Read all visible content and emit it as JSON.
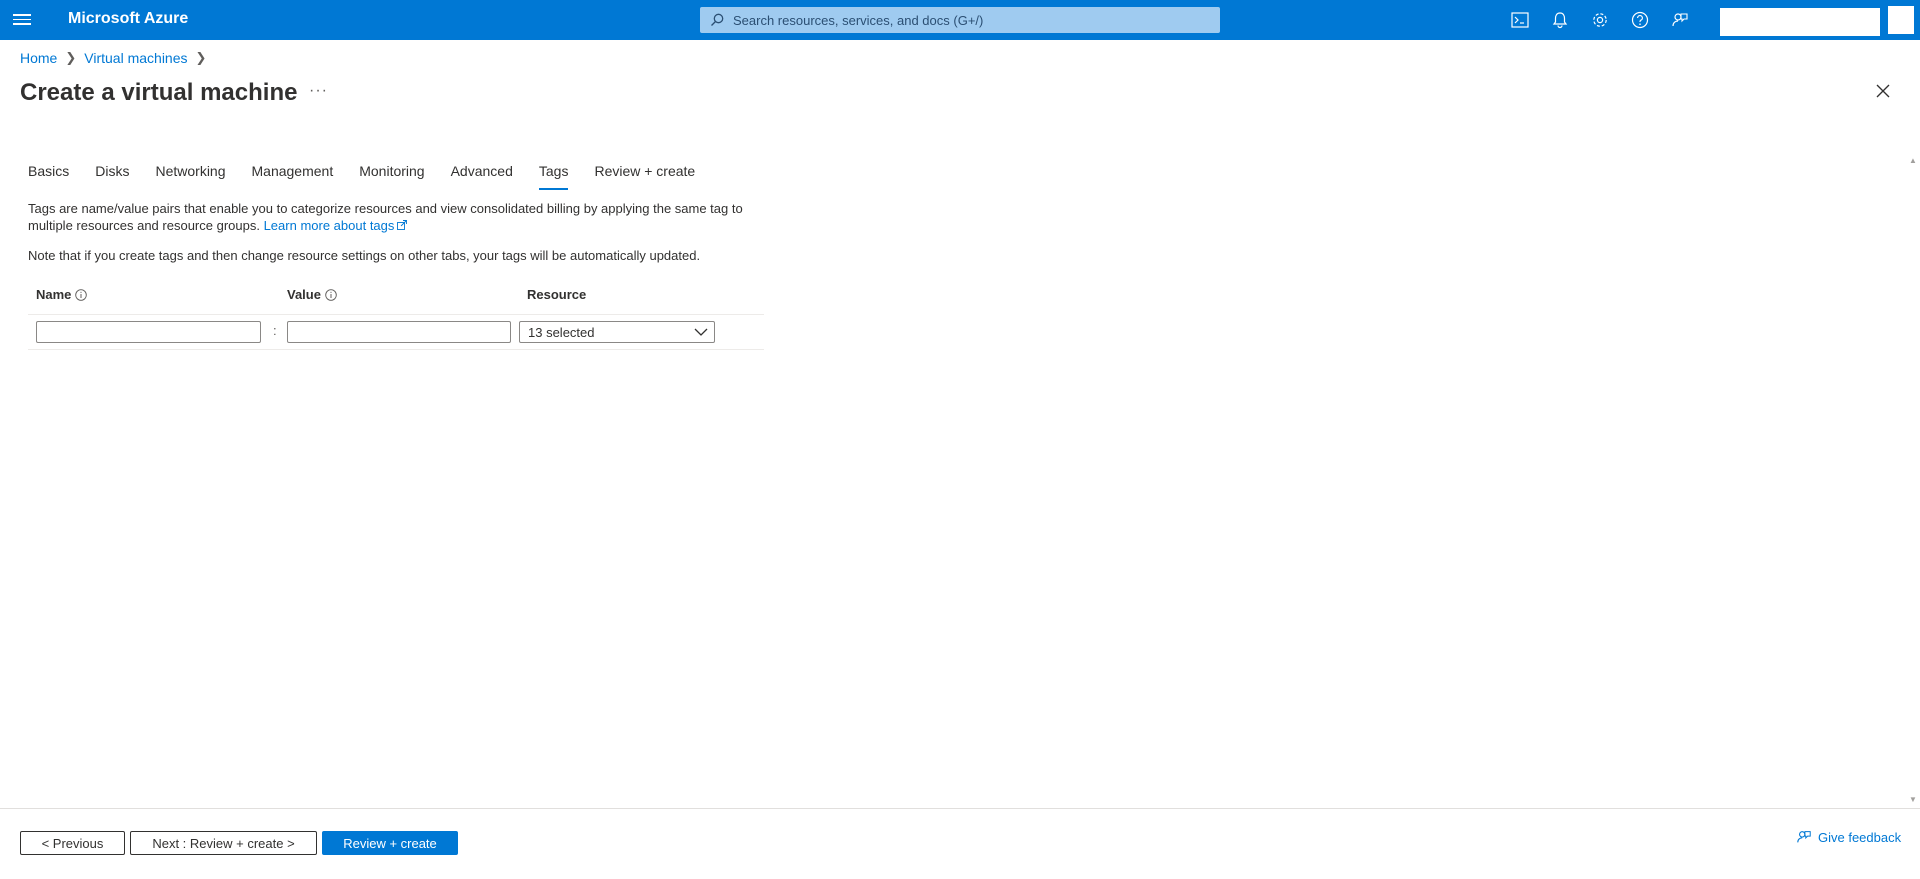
{
  "topbar": {
    "brand": "Microsoft Azure",
    "search_placeholder": "Search resources, services, and docs (G+/)",
    "icons": [
      "cloud-shell-icon",
      "notifications-icon",
      "settings-icon",
      "help-icon",
      "feedback-icon"
    ],
    "color": "#0078d4"
  },
  "breadcrumb": {
    "home": "Home",
    "virtual_machines": "Virtual machines"
  },
  "page": {
    "title": "Create a virtual machine",
    "more": "···"
  },
  "tabs": [
    {
      "label": "Basics"
    },
    {
      "label": "Disks"
    },
    {
      "label": "Networking"
    },
    {
      "label": "Management"
    },
    {
      "label": "Monitoring"
    },
    {
      "label": "Advanced"
    },
    {
      "label": "Tags",
      "active": true
    },
    {
      "label": "Review + create"
    }
  ],
  "content": {
    "description": "Tags are name/value pairs that enable you to categorize resources and view consolidated billing by applying the same tag to multiple resources and resource groups.",
    "learn_more": "Learn more about tags",
    "note": "Note that if you create tags and then change resource settings on other tabs, your tags will be automatically updated."
  },
  "table": {
    "headers": {
      "name": "Name",
      "value": "Value",
      "resource": "Resource"
    },
    "row": {
      "name_value": "",
      "value_value": "",
      "separator": ":",
      "resource_selected": "13 selected"
    }
  },
  "footer": {
    "previous": "< Previous",
    "next": "Next : Review + create >",
    "review_create": "Review + create",
    "give_feedback": "Give feedback"
  }
}
